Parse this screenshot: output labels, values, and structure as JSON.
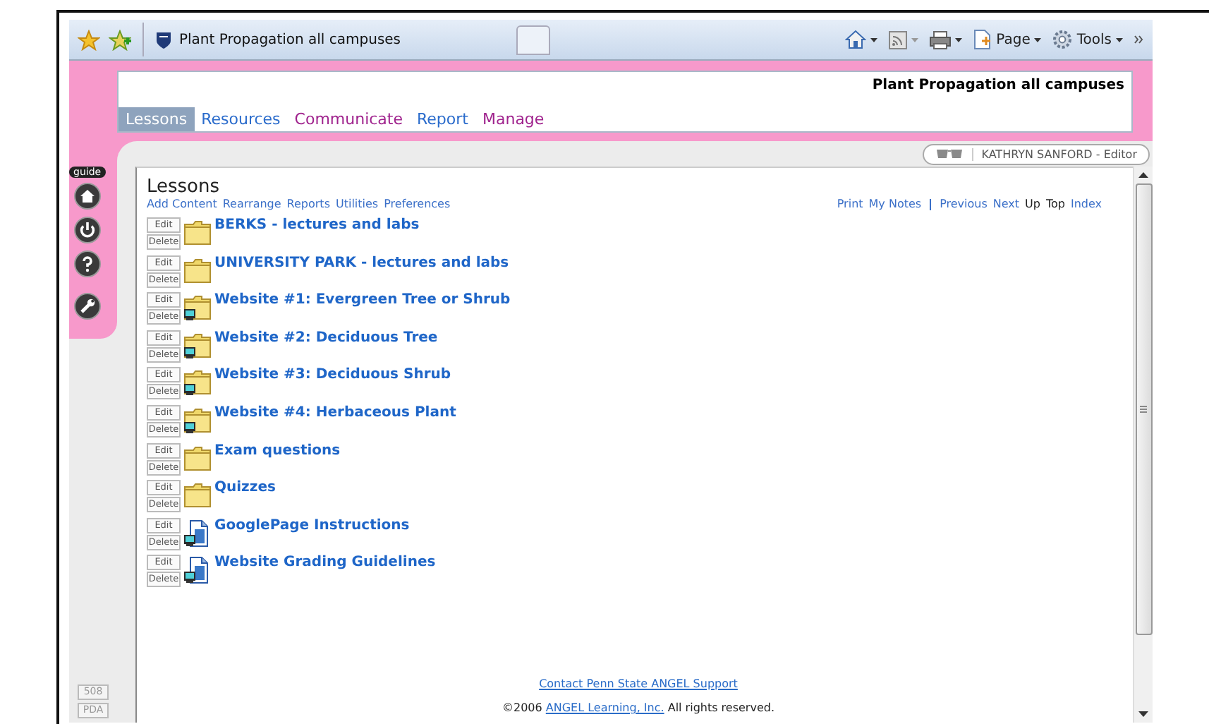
{
  "browser": {
    "tab_title": "Plant Propagation all campuses",
    "toolbar": [
      {
        "kind": "home"
      },
      {
        "kind": "feeds"
      },
      {
        "kind": "print"
      },
      {
        "kind": "page",
        "label": "Page"
      },
      {
        "kind": "tools",
        "label": "Tools"
      }
    ]
  },
  "header": {
    "course_title": "Plant Propagation all campuses",
    "tabs": [
      {
        "label": "Lessons",
        "selected": true,
        "color": "#8ea3bd"
      },
      {
        "label": "Resources",
        "selected": false,
        "color": "#2b6ccc"
      },
      {
        "label": "Communicate",
        "selected": false,
        "color": "#a0248e"
      },
      {
        "label": "Report",
        "selected": false,
        "color": "#2b6ccc"
      },
      {
        "label": "Manage",
        "selected": false,
        "color": "#a0248e"
      }
    ]
  },
  "user": {
    "name": "KATHRYN SANFORD - Editor"
  },
  "rail": {
    "label": "guide",
    "buttons": [
      {
        "kind": "home"
      },
      {
        "kind": "power"
      },
      {
        "kind": "help"
      },
      {
        "kind": "wrench"
      }
    ],
    "modes": [
      "508",
      "PDA"
    ]
  },
  "content": {
    "heading": "Lessons",
    "actions": [
      "Add Content",
      "Rearrange",
      "Reports",
      "Utilities",
      "Preferences"
    ],
    "nav_left": [
      "Print",
      "My Notes"
    ],
    "nav_right": [
      {
        "label": "Previous",
        "disabled": false
      },
      {
        "label": "Next",
        "disabled": false
      },
      {
        "label": "Up",
        "disabled": true
      },
      {
        "label": "Top",
        "disabled": true
      },
      {
        "label": "Index",
        "disabled": false
      }
    ],
    "items": [
      {
        "kind": "folder",
        "title": "BERKS - lectures and labs",
        "edit": "Edit",
        "delete": "Delete"
      },
      {
        "kind": "folder",
        "title": "UNIVERSITY PARK - lectures and labs",
        "edit": "Edit",
        "delete": "Delete"
      },
      {
        "kind": "web-folder",
        "title": "Website #1: Evergreen Tree or Shrub",
        "edit": "Edit",
        "delete": "Delete"
      },
      {
        "kind": "web-folder",
        "title": "Website #2: Deciduous Tree",
        "edit": "Edit",
        "delete": "Delete"
      },
      {
        "kind": "web-folder",
        "title": "Website #3: Deciduous Shrub",
        "edit": "Edit",
        "delete": "Delete"
      },
      {
        "kind": "web-folder",
        "title": "Website #4: Herbaceous Plant",
        "edit": "Edit",
        "delete": "Delete"
      },
      {
        "kind": "folder",
        "title": "Exam questions",
        "edit": "Edit",
        "delete": "Delete"
      },
      {
        "kind": "folder",
        "title": "Quizzes",
        "edit": "Edit",
        "delete": "Delete"
      },
      {
        "kind": "page",
        "title": "GooglePage Instructions",
        "edit": "Edit",
        "delete": "Delete"
      },
      {
        "kind": "page",
        "title": "Website Grading Guidelines",
        "edit": "Edit",
        "delete": "Delete"
      }
    ]
  },
  "footer": {
    "support_link": "Contact Penn State ANGEL Support",
    "copyright_before": "©2006",
    "copyright_link": "ANGEL Learning, Inc.",
    "copyright_after": "All rights reserved."
  }
}
